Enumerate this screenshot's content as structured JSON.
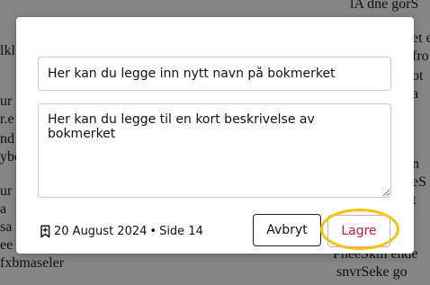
{
  "background_page": {
    "fragments": [
      "lA dne gorS",
      "et e",
      "fro",
      "ot",
      "a",
      "lkl",
      "ur",
      "r.e",
      "nd",
      "ybe",
      "n",
      "eS",
      "t",
      "a",
      "ur",
      "sa",
      "ee",
      "fxbmaseler",
      "r",
      "PneeSkm ende",
      "snvrSeke go"
    ]
  },
  "dialog": {
    "name_input": {
      "placeholder": "Her kan du legge inn nytt navn på bokmerket",
      "value": ""
    },
    "description_textarea": {
      "placeholder": "Her kan du legge til en kort beskrivelse av bokmerket",
      "value": ""
    },
    "meta": {
      "icon": "bookmark-icon",
      "date": "20 August 2024",
      "separator": "•",
      "page_label": "Side 14"
    },
    "buttons": {
      "cancel_label": "Avbryt",
      "save_label": "Lagre"
    },
    "colors": {
      "save_text": "#c8173f",
      "save_border": "#e3a5b6",
      "highlight": "#f4c40c"
    }
  }
}
